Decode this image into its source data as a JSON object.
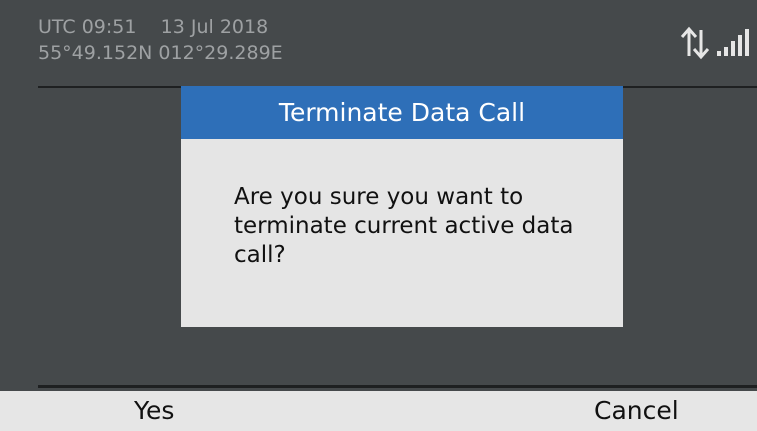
{
  "status": {
    "time": "UTC 09:51",
    "date": "13 Jul 2018",
    "latitude": "55°49.152N",
    "longitude": "012°29.289E",
    "icons": [
      "data-transfer-icon",
      "signal-strength-icon"
    ]
  },
  "dialog": {
    "title": "Terminate Data Call",
    "message": "Are you sure you want to terminate current active data call?",
    "header_color": "#2e6fb8"
  },
  "softkeys": {
    "left_label": "Yes",
    "right_label": "Cancel"
  },
  "colors": {
    "background": "#45494b",
    "status_text": "#9ea1a3",
    "softkey_bar": "#e6e6e6"
  }
}
